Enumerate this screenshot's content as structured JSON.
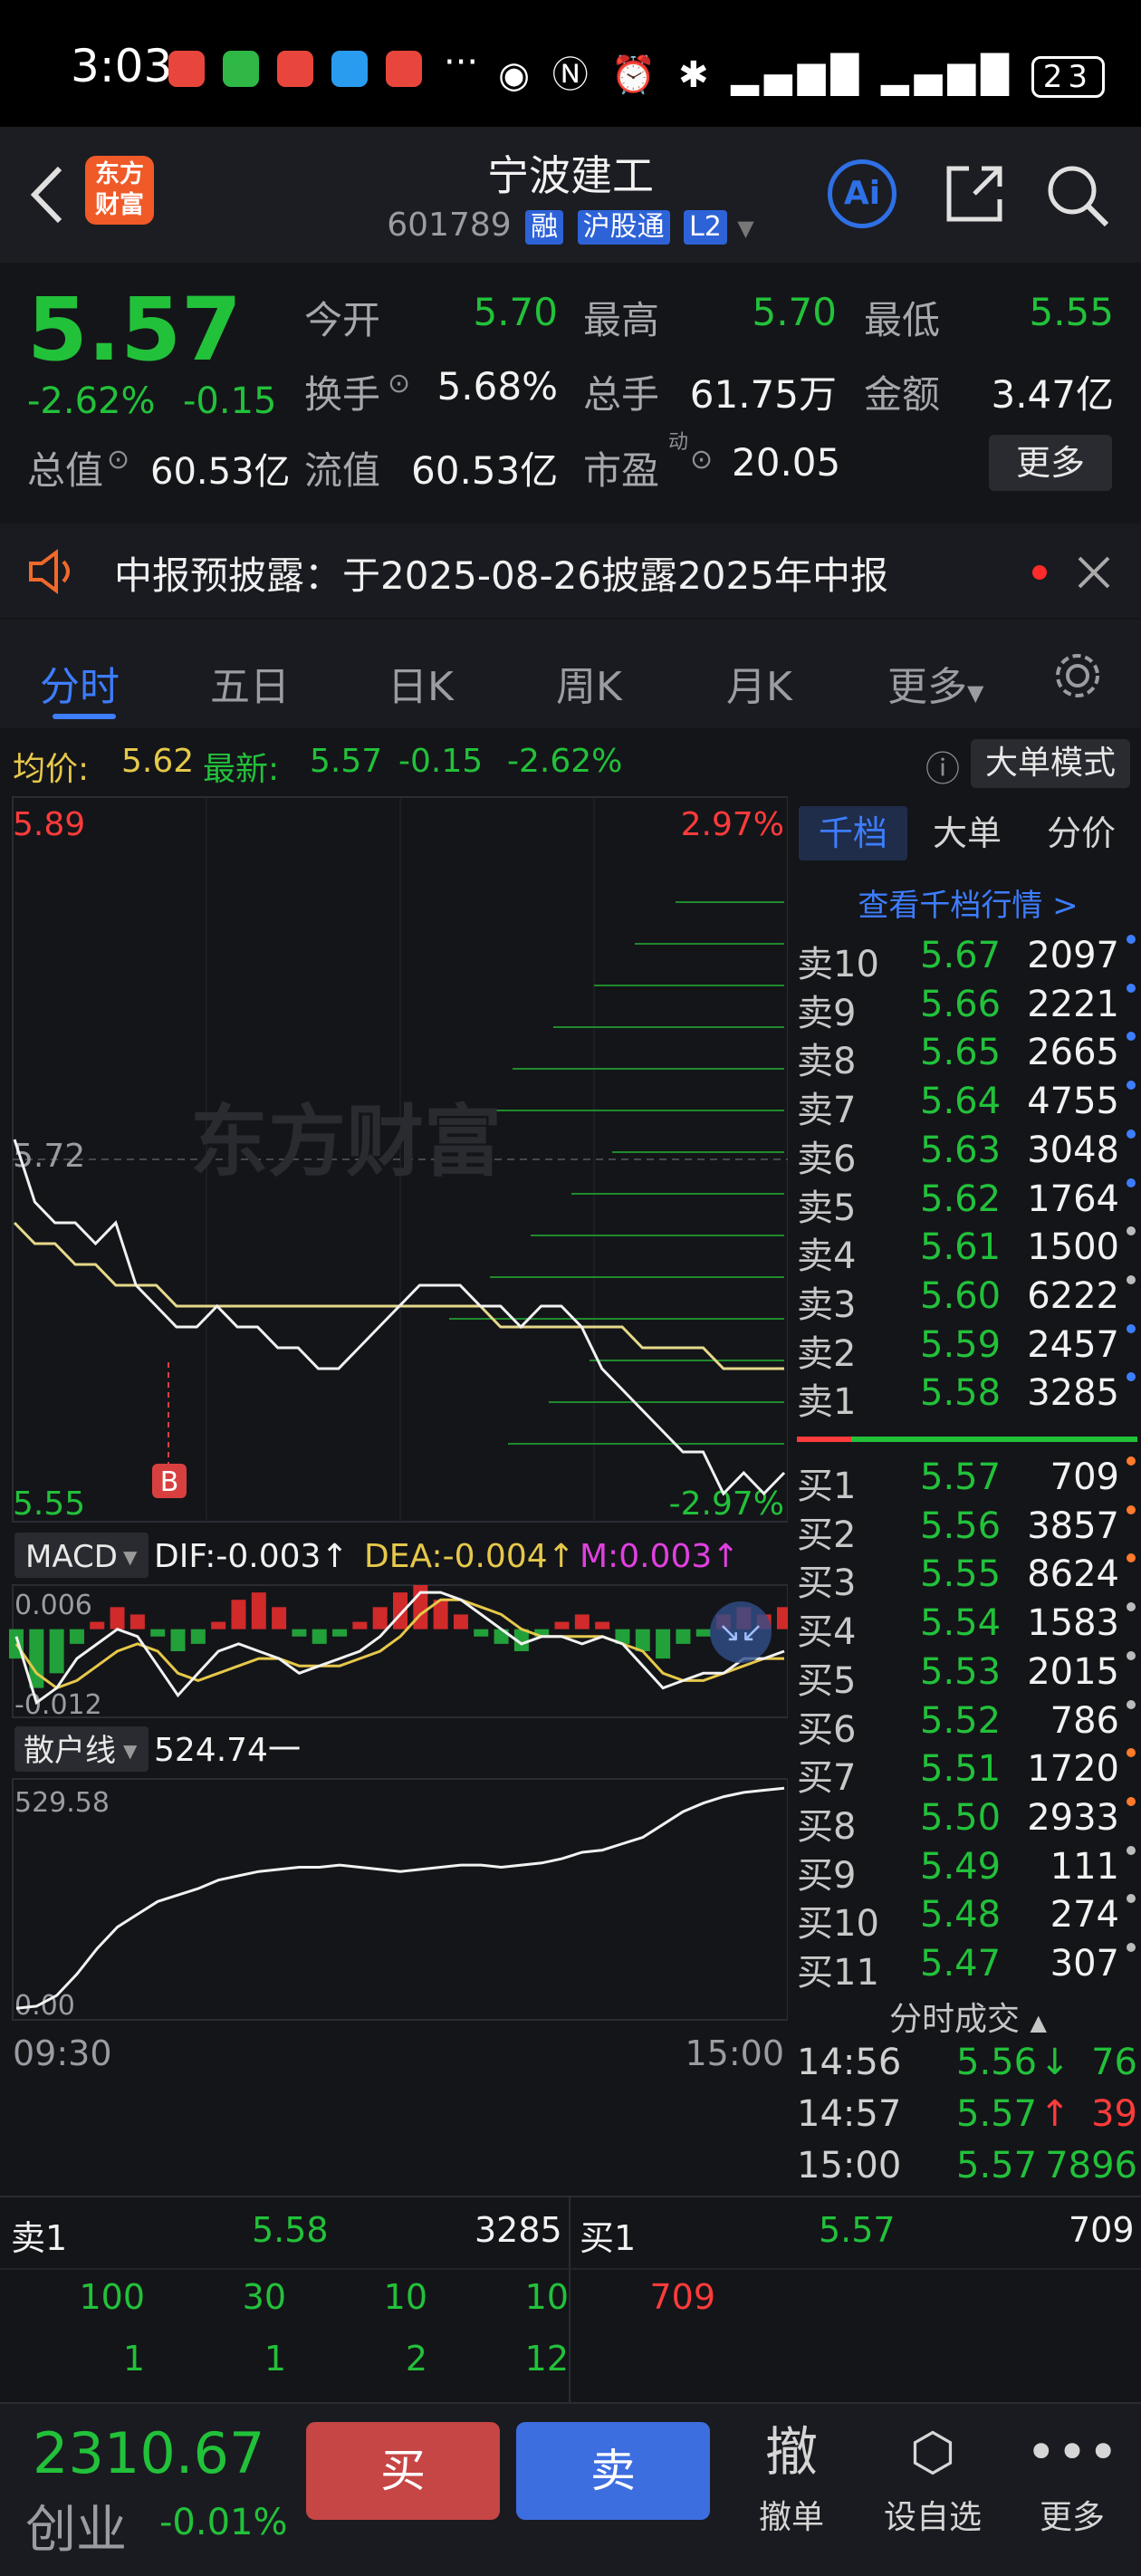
{
  "status_bar": {
    "time": "3:03",
    "dots": "···",
    "battery": "23"
  },
  "header": {
    "logo_text_line1": "东方",
    "logo_text_line2": "财富",
    "stock_name": "宁波建工",
    "stock_code": "601789",
    "tags": [
      "融",
      "沪股通",
      "L2"
    ],
    "ai_label": "Ai"
  },
  "quote": {
    "price": "5.57",
    "change_pct": "-2.62%",
    "change": "-0.15",
    "open_label": "今开",
    "open": "5.70",
    "high_label": "最高",
    "high": "5.70",
    "low_label": "最低",
    "low": "5.55",
    "turnover_label": "换手",
    "turnover": "5.68%",
    "volume_label": "总手",
    "volume": "61.75万",
    "amount_label": "金额",
    "amount": "3.47亿",
    "mktcap_label": "总值",
    "mktcap": "60.53亿",
    "float_label": "流值",
    "float": "60.53亿",
    "pe_label": "市盈",
    "pe_sup": "动",
    "pe": "20.05",
    "more_label": "更多"
  },
  "notice": {
    "text": "中报预披露：于2025-08-26披露2025年中报"
  },
  "tabs": [
    "分时",
    "五日",
    "日K",
    "周K",
    "月K",
    "更多"
  ],
  "chart_info": {
    "avg_label": "均价:",
    "avg": "5.62",
    "latest_label": "最新:",
    "latest": "5.57",
    "change": "-0.15",
    "change_pct": "-2.62%",
    "mode_button": "大单模式"
  },
  "chart_data": [
    {
      "type": "line",
      "title": "分时",
      "ylim": [
        5.55,
        5.89
      ],
      "y_labels": {
        "top": "5.89",
        "mid": "5.72",
        "bottom": "5.55",
        "top_pct": "2.97%",
        "bottom_pct": "-2.97%"
      },
      "watermark": "东方财富",
      "x_labels": [
        "09:30",
        "15:00"
      ],
      "series": [
        {
          "name": "价格",
          "color": "#f2f2f2",
          "values": [
            5.73,
            5.7,
            5.69,
            5.69,
            5.68,
            5.69,
            5.66,
            5.65,
            5.64,
            5.64,
            5.65,
            5.64,
            5.64,
            5.63,
            5.63,
            5.62,
            5.62,
            5.63,
            5.64,
            5.65,
            5.66,
            5.66,
            5.66,
            5.65,
            5.65,
            5.64,
            5.65,
            5.65,
            5.64,
            5.62,
            5.61,
            5.6,
            5.59,
            5.58,
            5.58,
            5.56,
            5.57,
            5.56,
            5.57
          ]
        },
        {
          "name": "均价",
          "color": "#e6d98a",
          "values": [
            5.69,
            5.68,
            5.68,
            5.67,
            5.67,
            5.66,
            5.66,
            5.66,
            5.65,
            5.65,
            5.65,
            5.65,
            5.65,
            5.65,
            5.65,
            5.65,
            5.65,
            5.65,
            5.65,
            5.65,
            5.65,
            5.65,
            5.65,
            5.65,
            5.64,
            5.64,
            5.64,
            5.64,
            5.64,
            5.64,
            5.64,
            5.63,
            5.63,
            5.63,
            5.63,
            5.62,
            5.62,
            5.62,
            5.62
          ]
        }
      ],
      "marker": "B"
    },
    {
      "type": "bar",
      "title": "MACD",
      "indicator_label": "MACD",
      "dif_label": "DIF:-0.003",
      "dea_label": "DEA:-0.004",
      "m_label": "M:0.003",
      "ylim": [
        -0.012,
        0.006
      ],
      "y_labels": {
        "top": "0.006",
        "bottom": "-0.012"
      },
      "values": [
        -0.004,
        -0.008,
        -0.006,
        -0.002,
        0.001,
        0.003,
        0.002,
        -0.001,
        -0.003,
        -0.002,
        0.001,
        0.004,
        0.005,
        0.003,
        -0.001,
        -0.002,
        -0.001,
        0.001,
        0.003,
        0.005,
        0.006,
        0.004,
        0.002,
        -0.001,
        -0.002,
        -0.003,
        -0.001,
        0.001,
        0.002,
        0.001,
        -0.002,
        -0.003,
        -0.004,
        -0.002,
        -0.001,
        0.002,
        0.003,
        0.002,
        0.003
      ],
      "series": [
        {
          "name": "DIF",
          "color": "#f2f2f2",
          "values": [
            -0.001,
            -0.01,
            -0.008,
            -0.004,
            -0.002,
            0.0,
            -0.001,
            -0.005,
            -0.009,
            -0.006,
            -0.003,
            -0.002,
            -0.003,
            -0.004,
            -0.006,
            -0.005,
            -0.004,
            -0.003,
            -0.001,
            0.002,
            0.005,
            0.005,
            0.004,
            0.002,
            0.0,
            -0.002,
            -0.001,
            -0.001,
            -0.002,
            -0.001,
            -0.002,
            -0.005,
            -0.008,
            -0.007,
            -0.006,
            -0.006,
            -0.004,
            -0.004,
            -0.003
          ]
        },
        {
          "name": "DEA",
          "color": "#e6c84a",
          "values": [
            -0.002,
            -0.006,
            -0.008,
            -0.007,
            -0.005,
            -0.003,
            -0.002,
            -0.003,
            -0.006,
            -0.007,
            -0.006,
            -0.005,
            -0.004,
            -0.004,
            -0.005,
            -0.005,
            -0.005,
            -0.004,
            -0.003,
            -0.001,
            0.002,
            0.004,
            0.004,
            0.003,
            0.002,
            0.0,
            -0.001,
            -0.001,
            -0.001,
            -0.001,
            -0.002,
            -0.003,
            -0.006,
            -0.007,
            -0.007,
            -0.006,
            -0.005,
            -0.004,
            -0.004
          ]
        }
      ]
    },
    {
      "type": "line",
      "title": "散户线",
      "indicator_label": "散户线",
      "current": "524.74",
      "ylim": [
        0,
        529.58
      ],
      "y_labels": {
        "top": "529.58",
        "bottom": "0.00"
      },
      "series": [
        {
          "name": "散户线",
          "color": "#f2f2f2",
          "values": [
            10,
            15,
            40,
            90,
            150,
            200,
            230,
            260,
            275,
            290,
            310,
            320,
            330,
            335,
            340,
            340,
            345,
            340,
            335,
            330,
            335,
            340,
            345,
            345,
            340,
            345,
            350,
            360,
            375,
            380,
            395,
            410,
            440,
            470,
            490,
            505,
            515,
            520,
            524.74
          ]
        }
      ]
    }
  ],
  "orderbook": {
    "tabs": [
      "千档",
      "大单",
      "分价"
    ],
    "link": "查看千档行情 >",
    "asks": [
      {
        "label": "卖10",
        "price": "5.67",
        "vol": "2097",
        "dot": "#3d7dff"
      },
      {
        "label": "卖9",
        "price": "5.66",
        "vol": "2221",
        "dot": "#3d7dff"
      },
      {
        "label": "卖8",
        "price": "5.65",
        "vol": "2665",
        "dot": "#3d7dff"
      },
      {
        "label": "卖7",
        "price": "5.64",
        "vol": "4755",
        "dot": "#3d7dff"
      },
      {
        "label": "卖6",
        "price": "5.63",
        "vol": "3048",
        "dot": "#3d7dff"
      },
      {
        "label": "卖5",
        "price": "5.62",
        "vol": "1764",
        "dot": "#3d7dff"
      },
      {
        "label": "卖4",
        "price": "5.61",
        "vol": "1500",
        "dot": "#bbbbbb"
      },
      {
        "label": "卖3",
        "price": "5.60",
        "vol": "6222",
        "dot": "#bbbbbb"
      },
      {
        "label": "卖2",
        "price": "5.59",
        "vol": "2457",
        "dot": "#3d7dff"
      },
      {
        "label": "卖1",
        "price": "5.58",
        "vol": "3285",
        "dot": "#3d7dff"
      }
    ],
    "bids": [
      {
        "label": "买1",
        "price": "5.57",
        "vol": "709",
        "dot": "#ff7a2a"
      },
      {
        "label": "买2",
        "price": "5.56",
        "vol": "3857",
        "dot": "#ff7a2a"
      },
      {
        "label": "买3",
        "price": "5.55",
        "vol": "8624",
        "dot": "#ff7a2a"
      },
      {
        "label": "买4",
        "price": "5.54",
        "vol": "1583",
        "dot": "#bbbbbb"
      },
      {
        "label": "买5",
        "price": "5.53",
        "vol": "2015",
        "dot": "#bbbbbb"
      },
      {
        "label": "买6",
        "price": "5.52",
        "vol": "786",
        "dot": "#bbbbbb"
      },
      {
        "label": "买7",
        "price": "5.51",
        "vol": "1720",
        "dot": "#ff7a2a"
      },
      {
        "label": "买8",
        "price": "5.50",
        "vol": "2933",
        "dot": "#ff7a2a"
      },
      {
        "label": "买9",
        "price": "5.49",
        "vol": "111",
        "dot": "#bbbbbb"
      },
      {
        "label": "买10",
        "price": "5.48",
        "vol": "274",
        "dot": "#bbbbbb"
      },
      {
        "label": "买11",
        "price": "5.47",
        "vol": "307",
        "dot": "#bbbbbb"
      }
    ],
    "ticks_title": "分时成交",
    "ticks": [
      {
        "time": "14:56",
        "price": "5.56",
        "arrow": "↓",
        "vol": "76",
        "color": "#22c13a"
      },
      {
        "time": "14:57",
        "price": "5.57",
        "arrow": "↑",
        "vol": "39",
        "color": "#ff3b3b"
      },
      {
        "time": "15:00",
        "price": "5.57",
        "arrow": "",
        "vol": "7896",
        "color": "#22c13a"
      }
    ]
  },
  "depth": {
    "ask_label": "卖1",
    "ask_price": "5.58",
    "ask_vol": "3285",
    "bid_label": "买1",
    "bid_price": "5.57",
    "bid_vol": "709",
    "ask_queue_row1": [
      "100",
      "30",
      "10",
      "10"
    ],
    "ask_queue_row2": [
      "1",
      "1",
      "2",
      "12"
    ],
    "bid_queue_row1": [
      "709"
    ]
  },
  "bottom_bar": {
    "index_value": "2310.67",
    "index_name": "创业",
    "index_change": "-0.01%",
    "buy": "买",
    "sell": "卖",
    "cancel_icon": "撤",
    "cancel": "撤单",
    "watchlist": "设自选",
    "more": "更多"
  },
  "colors": {
    "up": "#ff3b3b",
    "down": "#22c13a",
    "accent": "#3d7dff",
    "background": "#141519"
  }
}
